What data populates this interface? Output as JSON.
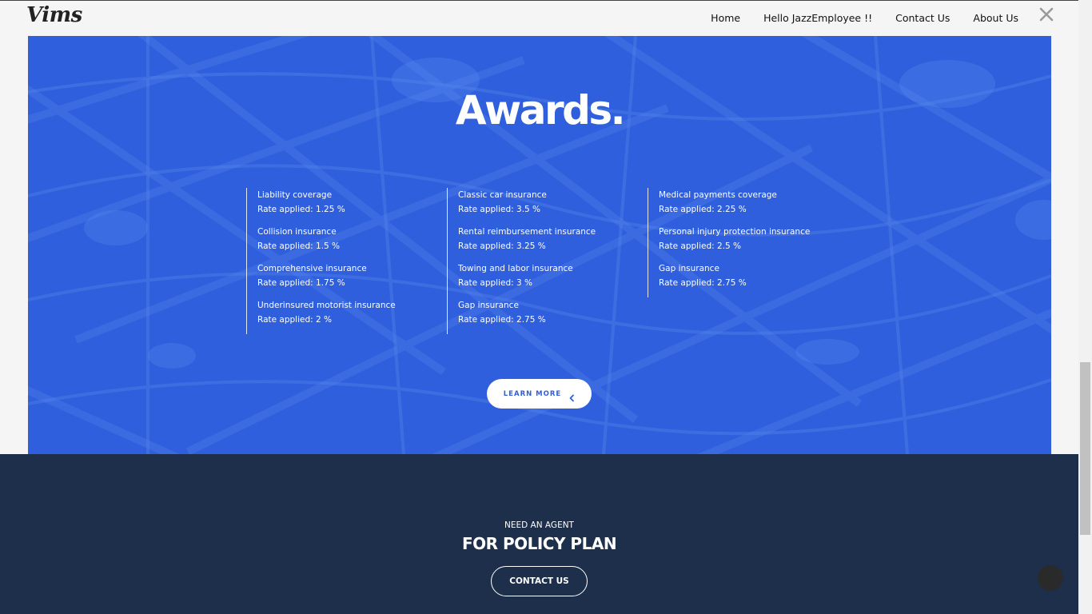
{
  "header": {
    "logo": "Vims",
    "nav": [
      {
        "label": "Home"
      },
      {
        "label": "Hello JazzEmployee !!"
      },
      {
        "label": "Contact Us"
      },
      {
        "label": "About Us"
      }
    ],
    "close_icon": "close-x-icon"
  },
  "awards": {
    "title": "Awards.",
    "background_color": "#2f5fdd",
    "columns": [
      {
        "items": [
          {
            "name": "Liability coverage",
            "rate": "Rate applied: 1.25 %"
          },
          {
            "name": "Collision insurance",
            "rate": "Rate applied: 1.5 %"
          },
          {
            "name": "Comprehensive insurance",
            "rate": "Rate applied: 1.75 %"
          },
          {
            "name": "Underinsured motorist insurance",
            "rate": "Rate applied: 2 %"
          }
        ]
      },
      {
        "items": [
          {
            "name": "Classic car insurance",
            "rate": "Rate applied: 3.5 %"
          },
          {
            "name": "Rental reimbursement insurance",
            "rate": "Rate applied: 3.25 %"
          },
          {
            "name": "Towing and labor insurance",
            "rate": "Rate applied: 3 %"
          },
          {
            "name": "Gap insurance",
            "rate": "Rate applied: 2.75 %"
          }
        ]
      },
      {
        "items": [
          {
            "name": "Medical payments coverage",
            "rate": "Rate applied: 2.25 %"
          },
          {
            "name": "Personal injury protection insurance",
            "rate": "Rate applied: 2.5 %"
          },
          {
            "name": "Gap insurance",
            "rate": "Rate applied: 2.75 %"
          }
        ]
      }
    ],
    "learn_more": "LEARN MORE"
  },
  "agent": {
    "subtitle": "NEED AN AGENT",
    "title": "FOR POLICY PLAN",
    "contact_button": "CONTACT US",
    "background_color": "#1d2f4b"
  }
}
